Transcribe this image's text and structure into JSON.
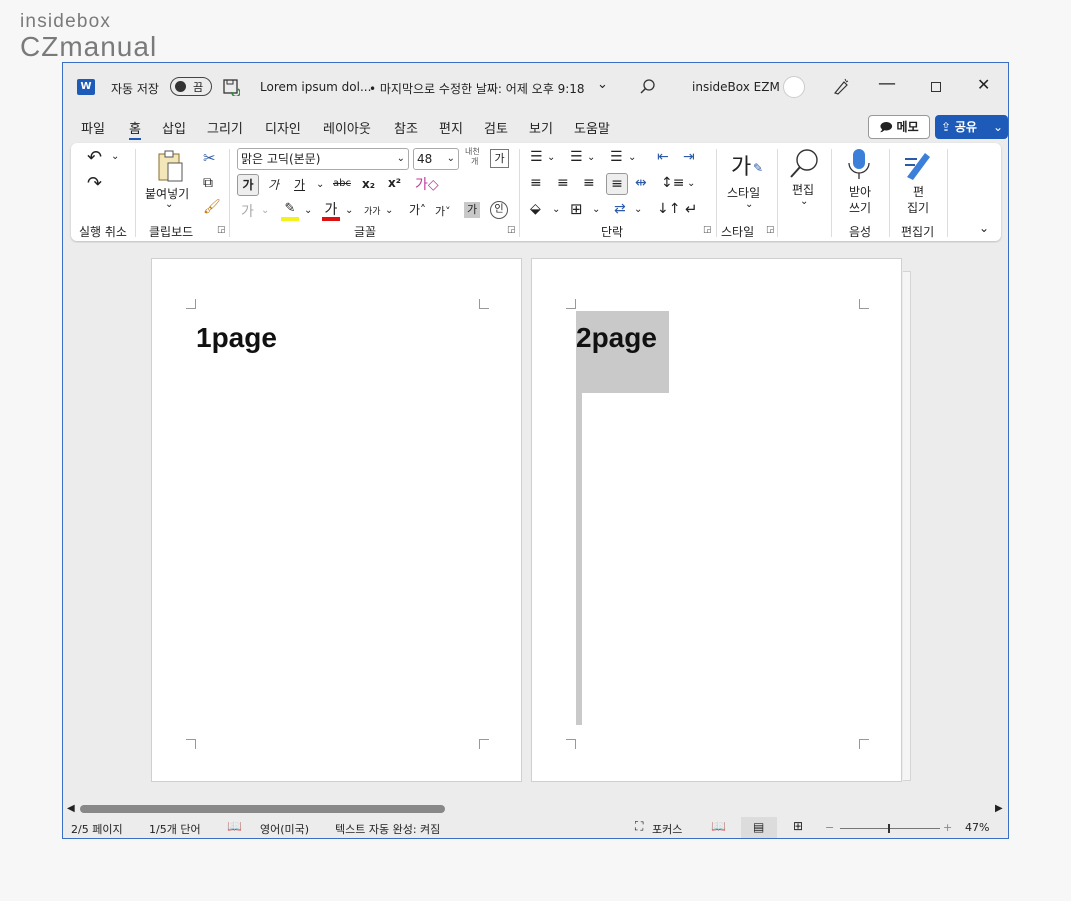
{
  "watermark": {
    "line1": "insidebox",
    "line2": "CZmanual"
  },
  "titlebar": {
    "app_icon": "W",
    "autosave_label": "자동 저장",
    "autosave_state": "끔",
    "doc_name": "Lorem ipsum dol...",
    "last_modified": "• 마지막으로 수정한 날짜: 어제 오후 9:18",
    "user_name": "insideBox EZM"
  },
  "menu": {
    "tabs": [
      "파일",
      "홈",
      "삽입",
      "그리기",
      "디자인",
      "레이아웃",
      "참조",
      "편지",
      "검토",
      "보기",
      "도움말"
    ],
    "active_tab": "홈",
    "memo_label": "메모",
    "share_label": "공유"
  },
  "ribbon": {
    "undo_group": "실행 취소",
    "clipboard": {
      "paste_label": "붙여넣기",
      "group_label": "클립보드"
    },
    "font": {
      "font_name": "맑은 고딕(본문)",
      "font_size": "48",
      "phonetic_label_top": "내천",
      "phonetic_label_bottom": "개",
      "bold": "가",
      "italic": "가",
      "underline": "가",
      "strike": "abc",
      "subscript": "x₂",
      "superscript": "x²",
      "group_label": "글꼴"
    },
    "paragraph": {
      "group_label": "단락"
    },
    "styles": {
      "label": "스타일",
      "group_label": "스타일"
    },
    "editing": {
      "label": "편집"
    },
    "voice": {
      "label_line1": "받아",
      "label_line2": "쓰기",
      "group_label": "음성"
    },
    "editor": {
      "label_line1": "편",
      "label_line2": "집기",
      "group_label": "편집기"
    }
  },
  "document": {
    "page1_text": "1page",
    "page2_text": "2page"
  },
  "status": {
    "page": "2/5 페이지",
    "words": "1/5개 단어",
    "language": "영어(미국)",
    "autocomplete": "텍스트 자동 완성: 켜짐",
    "focus": "포커스",
    "zoom": "47%"
  }
}
